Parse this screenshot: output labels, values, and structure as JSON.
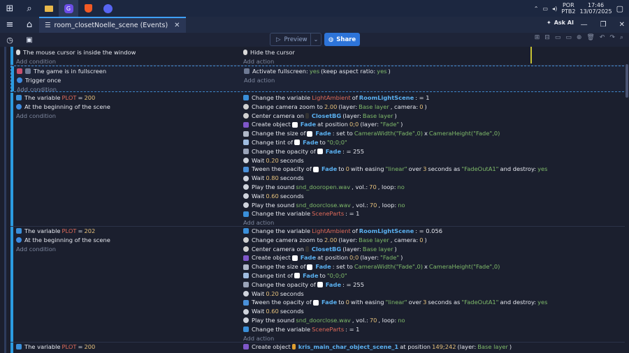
{
  "taskbar": {
    "tray": {
      "lang_top": "POR",
      "lang_bottom": "PTB2",
      "time": "17:46",
      "date": "13/07/2025"
    }
  },
  "tab": {
    "title": "room_closetNoelle_scene (Events)"
  },
  "toolbar": {
    "preview_label": "Preview",
    "share_label": "Share",
    "askai_label": "Ask AI"
  },
  "events": [
    {
      "conditions": [
        {
          "icon": "mouse-icon",
          "text": "The mouse cursor is inside the window"
        }
      ],
      "add_condition": "Add condition",
      "actions": [
        {
          "icon": "mouse-icon",
          "text": "Hide the cursor"
        }
      ],
      "add_action": "Add action"
    },
    {
      "conditions": [
        {
          "icon": "fullscreen-icon",
          "text": "The game is in fullscreen"
        },
        {
          "icon": "trigger-icon",
          "text": "Trigger once"
        }
      ],
      "add_condition": "Add condition",
      "actions": [
        {
          "icon": "fullscreen-icon",
          "pre": "Activate fullscreen: ",
          "yes1": "yes",
          "mid": " (keep aspect ratio: ",
          "yes2": "yes",
          "post": ")"
        }
      ],
      "add_action": "Add action"
    },
    {
      "conditions": [
        {
          "type": "var",
          "pre": "The variable ",
          "var": "PLOT",
          "op": " = ",
          "val": "200"
        },
        {
          "icon": "scene-icon",
          "text": "At the beginning of the scene"
        }
      ],
      "add_condition": "Add condition",
      "actions": [
        "Change the variable|LightAmbient|of|RoomLightScene|: = 1",
        "Change camera zoom to 2.00 (layer: Base layer, camera: 0)",
        "Center camera on ClosetBG (layer: Base layer)",
        "Create object Fade at position 0;0 (layer: \"Fade\")",
        "Change the size of Fade: set to CameraWidth(\"Fade\",0) x CameraHeight(\"Fade\",0)",
        "Change tint of Fade to \"0;0;0\"",
        "Change the opacity of Fade: = 255",
        "Wait 0.20 seconds",
        "Tween the opacity of Fade to 0 with easing \"linear\" over 3 seconds as \"FadeOutA1\" and destroy: yes",
        "Wait 0.80 seconds",
        "Play the sound snd_dooropen.wav, vol.: 70, loop: no",
        "Wait 0.60 seconds",
        "Play the sound snd_doorclose.wav, vol.: 70, loop: no",
        "Change the variable SceneParts: = 1"
      ],
      "add_action": "Add action"
    },
    {
      "conditions": [
        {
          "type": "var",
          "pre": "The variable ",
          "var": "PLOT",
          "op": " = ",
          "val": "202"
        },
        {
          "icon": "scene-icon",
          "text": "At the beginning of the scene"
        }
      ],
      "add_condition": "Add condition",
      "add_action": "Add action"
    },
    {
      "conditions": [
        {
          "type": "var",
          "pre": "The variable ",
          "var": "PLOT",
          "op": " = ",
          "val": "200"
        }
      ]
    }
  ],
  "rich_actions": {
    "e3_1": {
      "pre": "Change the variable ",
      "var": "LightAmbient",
      "mid": " of ",
      "obj": "RoomLightScene",
      "post": ": = 1"
    },
    "e4_1": {
      "pre": "Change the variable ",
      "var": "LightAmbient",
      "mid": " of ",
      "obj": "RoomLightScene",
      "post": ": = 0.056"
    },
    "zoom": {
      "pre": "Change camera zoom to ",
      "num": "2.00",
      "mid": " (layer: ",
      "layer": "Base layer",
      "mid2": ", camera: ",
      "cam": "0",
      "post": ")"
    },
    "center": {
      "pre": "Center camera on ",
      "obj": "ClosetBG",
      "mid": " (layer: ",
      "layer": "Base layer",
      "post": ")"
    },
    "create": {
      "pre": "Create object ",
      "obj": "Fade",
      "mid": " at position ",
      "pos": "0;0",
      "mid2": " (layer: ",
      "layer": "\"Fade\"",
      "post": ")"
    },
    "size": {
      "pre": "Change the size of ",
      "obj": "Fade",
      "mid": ": set to ",
      "w": "CameraWidth(\"Fade\",0)",
      "x": " x ",
      "h": "CameraHeight(\"Fade\",0)"
    },
    "tint": {
      "pre": "Change tint of ",
      "obj": "Fade",
      "mid": " to ",
      "col": "\"0;0;0\""
    },
    "opacity": {
      "pre": "Change the opacity of ",
      "obj": "Fade",
      "post": ": = 255"
    },
    "wait020": {
      "pre": "Wait ",
      "num": "0.20",
      "post": " seconds"
    },
    "wait080": {
      "pre": "Wait ",
      "num": "0.80",
      "post": " seconds"
    },
    "wait060": {
      "pre": "Wait ",
      "num": "0.60",
      "post": " seconds"
    },
    "tween": {
      "pre": "Tween the opacity of ",
      "obj": "Fade",
      "mid": " to ",
      "to": "0",
      "mid2": " with easing ",
      "ease": "\"linear\"",
      "mid3": " over ",
      "dur": "3",
      "mid4": " seconds as ",
      "id": "\"FadeOutA1\"",
      "mid5": " and destroy: ",
      "d": "yes"
    },
    "sound_open": {
      "pre": "Play the sound ",
      "file": "snd_dooropen.wav",
      "mid": ", vol.: ",
      "vol": "70",
      "mid2": ", loop: ",
      "loop": "no"
    },
    "sound_close": {
      "pre": "Play the sound ",
      "file": "snd_doorclose.wav",
      "mid": ", vol.: ",
      "vol": "70",
      "mid2": ", loop: ",
      "loop": "no"
    },
    "scenepart": {
      "pre": "Change the variable ",
      "var": "SceneParts",
      "post": ": = 1"
    },
    "create_kris": {
      "pre": "Create object ",
      "obj": "kris_main_char_object_scene_1",
      "mid": " at position ",
      "pos": "149;242",
      "mid2": " (layer: ",
      "layer": "Base layer",
      "post": ")"
    }
  }
}
